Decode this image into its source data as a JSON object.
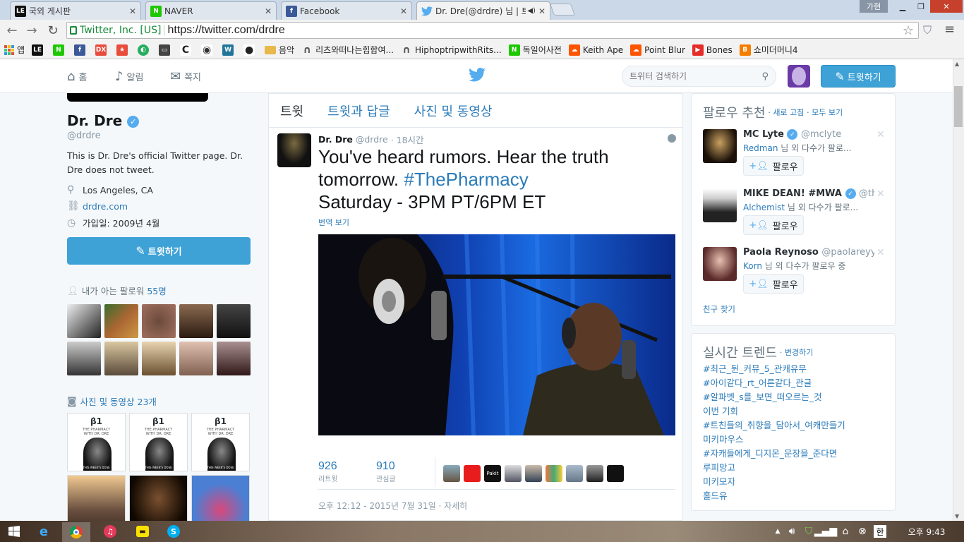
{
  "browser": {
    "tabs": [
      {
        "label": "국외 게시판",
        "icon": "LE"
      },
      {
        "label": "NAVER",
        "icon": "N"
      },
      {
        "label": "Facebook",
        "icon": "f"
      },
      {
        "label": "Dr. Dre(@drdre) 님 | 트",
        "icon": "twitter"
      }
    ],
    "profile": "가현",
    "ev_label": "Twitter, Inc. [US]",
    "url": "https://twitter.com/drdre",
    "bookmarks": [
      {
        "label": "앱",
        "color": "#c0392b"
      },
      {
        "label": "",
        "color": "#111111",
        "icon": "LE"
      },
      {
        "label": "",
        "color": "#1ec800",
        "icon": "N"
      },
      {
        "label": "",
        "color": "#3b5998",
        "icon": "f"
      },
      {
        "label": "",
        "color": "#e74c3c",
        "icon": "DX"
      },
      {
        "label": "",
        "color": "#e74c3c",
        "icon": "★"
      },
      {
        "label": "",
        "color": "#27ae60",
        "icon": "◐"
      },
      {
        "label": "",
        "color": "#444444",
        "icon": "▭"
      },
      {
        "label": "",
        "color": "#222222",
        "icon": "C"
      },
      {
        "label": "",
        "color": "#333333",
        "icon": "◉"
      },
      {
        "label": "",
        "color": "#21759b",
        "icon": "W"
      },
      {
        "label": "",
        "color": "#222222",
        "icon": "●"
      },
      {
        "label": "음악",
        "color": "#e8b84a",
        "icon": "folder"
      },
      {
        "label": "리츠와떠나는힙합여...",
        "color": "#555555",
        "icon": "∩"
      },
      {
        "label": "HiphoptripwithRits...",
        "color": "#555555",
        "icon": "∩"
      },
      {
        "label": "독일어사전",
        "color": "#1ec800",
        "icon": "N"
      },
      {
        "label": "Keith Ape",
        "color": "#ff5500",
        "icon": "☁"
      },
      {
        "label": "Point Blur",
        "color": "#ff5500",
        "icon": "☁"
      },
      {
        "label": "Bones",
        "color": "#e52d27",
        "icon": "▶"
      },
      {
        "label": "쇼미더머니4",
        "color": "#f57d00",
        "icon": "B"
      }
    ]
  },
  "nav": {
    "home": "홈",
    "notifications": "알림",
    "messages": "쪽지",
    "search_placeholder": "트위터 검색하기",
    "tweet_button": "트윗하기"
  },
  "profile": {
    "name": "Dr. Dre",
    "handle": "@drdre",
    "bio": "This is Dr. Dre's official Twitter page. Dr. Dre does not tweet.",
    "location": "Los Angeles, CA",
    "website": "drdre.com",
    "joined": "가입일: 2009년 4월",
    "tweet_button": "트윗하기",
    "followers_you_know_label": "내가 아는 팔로워",
    "followers_you_know_count": "55명",
    "media_label": "사진 및 동영상",
    "media_count": "23개",
    "media_card_title": "THE PHARMACY\nWITH DR. DRE",
    "media_card_sub": "THIS WEEK'S DOSE",
    "media_card_logo": "β1"
  },
  "timeline": {
    "tabs": [
      "트윗",
      "트윗과 답글",
      "사진 및 동영상"
    ],
    "tweet": {
      "author": "Dr. Dre",
      "handle": "@drdre",
      "time": "· 18시간",
      "text_line1": "You've heard rumors. Hear the truth",
      "text_line2": "tomorrow.",
      "hashtag": "#ThePharmacy",
      "text_line3": "Saturday - 3PM PT/6PM ET",
      "translate": "번역 보기",
      "retweets": "926",
      "retweets_label": "리트윗",
      "favorites": "910",
      "favorites_label": "관심글",
      "favoriter_avatars": [
        "Pakit"
      ],
      "timestamp": "오후 12:12 - 2015년 7월 31일 · 자세히"
    }
  },
  "who_to_follow": {
    "title": "팔로우 추천",
    "refresh": "· 새로 고침",
    "view_all": "· 모두 보기",
    "follow_label": "팔로우",
    "items": [
      {
        "name": "MC Lyte",
        "handle": "@mclyte",
        "via": "Redman",
        "sub_suffix": " 님 외 다수가 팔로..."
      },
      {
        "name": "MIKE DEAN! #MWA",
        "handle": "@th...",
        "via": "Alchemist",
        "sub_suffix": " 님 외 다수가 팔로..."
      },
      {
        "name": "Paola Reynoso",
        "handle": "@paolareyy",
        "via": "Korn",
        "sub_suffix": " 님 외 다수가 팔로우 중"
      }
    ],
    "find_friends": "친구 찾기"
  },
  "trends": {
    "title": "실시간 트렌드",
    "change": "· 변경하기",
    "items": [
      "#최근_뒨_커뮤_5_관캐유무",
      "#아이같다_rt_어른같다_관글",
      "#알파벳_s를_보면_떠오르는_것",
      "이번 기회",
      "#트친들의_취향을_담아서_여캐만들기",
      "미키마우스",
      "#자캐들에게_디지몬_문장을_준다면",
      "루피망고",
      "미키모자",
      "홀드유"
    ]
  },
  "taskbar": {
    "clock": "오후 9:43",
    "ime": "한"
  },
  "colors": {
    "twitter_blue": "#55acee",
    "link": "#2b7bb9",
    "tweet_button": "#3ea2d6",
    "verified": "#55acee"
  }
}
